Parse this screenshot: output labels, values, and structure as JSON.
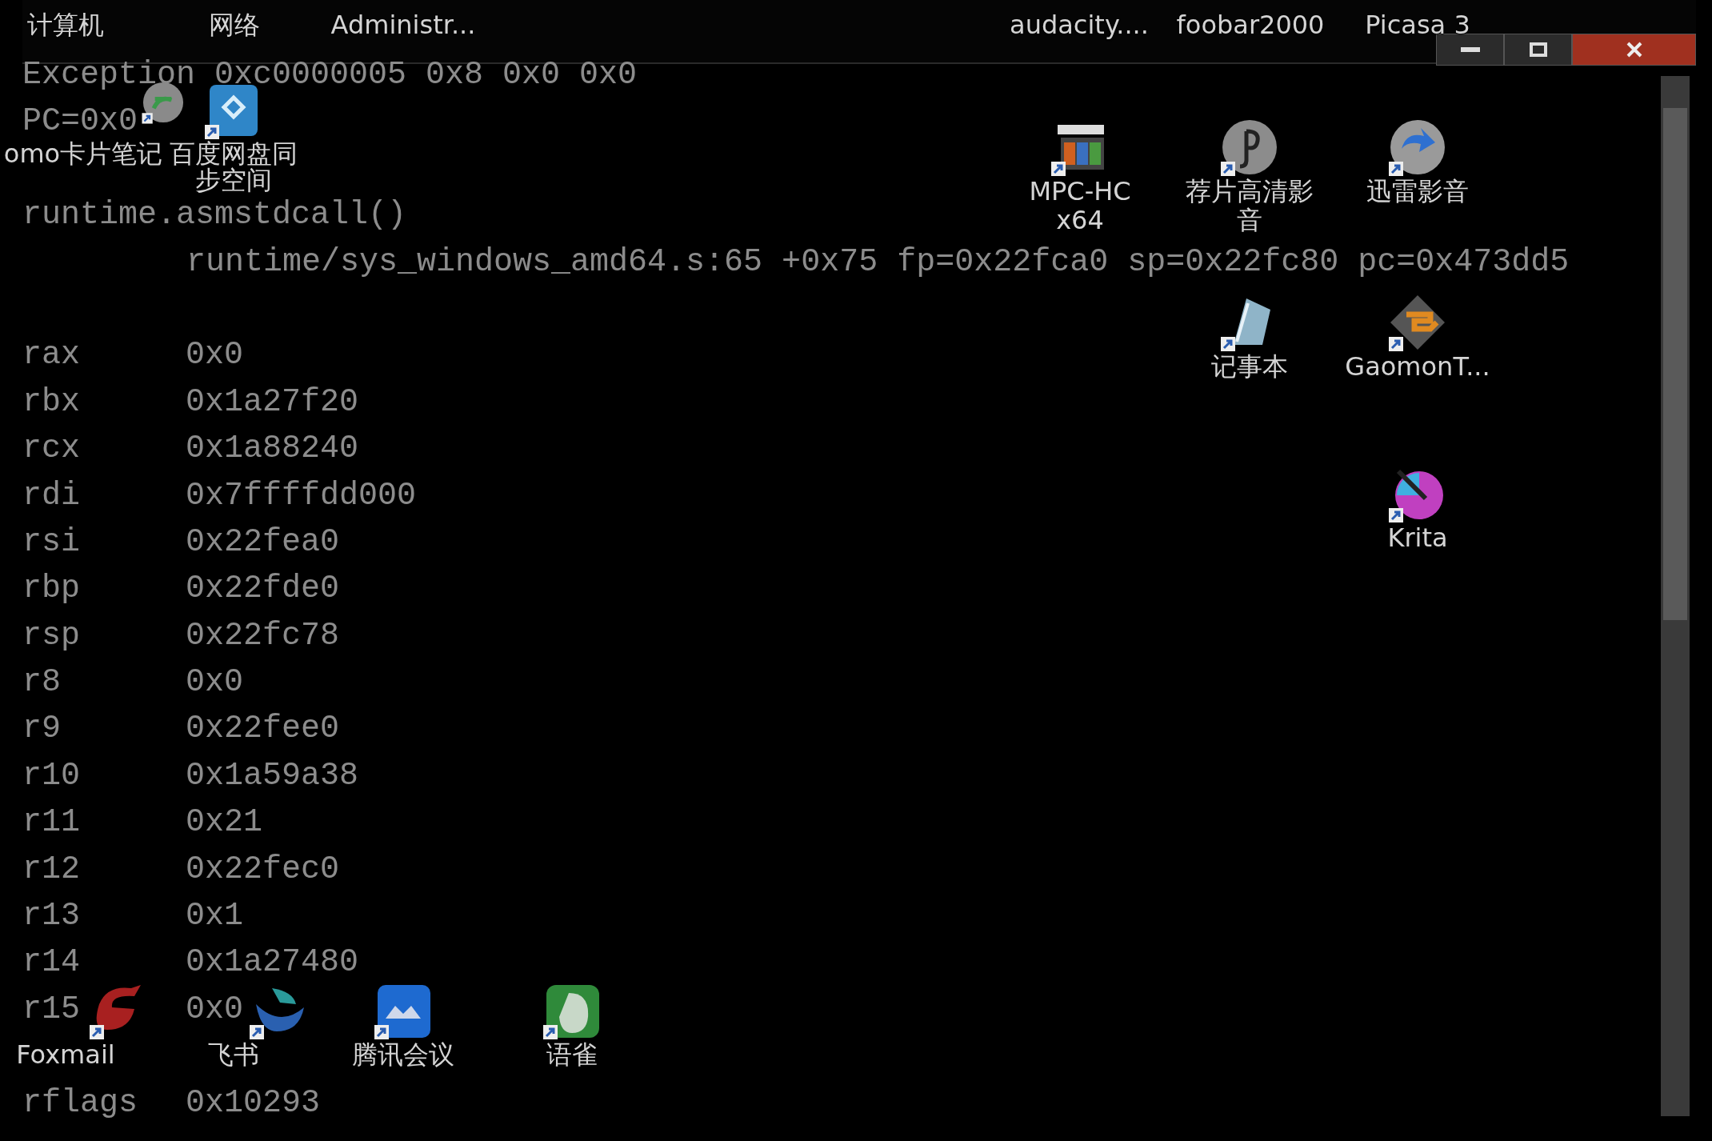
{
  "console": {
    "lines": [
      {
        "kind": "text",
        "text": "Exception 0xc0000005 0x8 0x0 0x0"
      },
      {
        "kind": "text",
        "text": "PC=0x0"
      },
      {
        "kind": "blank"
      },
      {
        "kind": "text",
        "text": "runtime.asmstdcall()"
      },
      {
        "kind": "indented",
        "text": "runtime/sys_windows_amd64.s:65 +0x75 fp=0x22fca0 sp=0x22fc80 pc=0x473dd5"
      },
      {
        "kind": "blank"
      },
      {
        "kind": "register",
        "name": "rax",
        "value": "0x0"
      },
      {
        "kind": "register",
        "name": "rbx",
        "value": "0x1a27f20"
      },
      {
        "kind": "register",
        "name": "rcx",
        "value": "0x1a88240"
      },
      {
        "kind": "register",
        "name": "rdi",
        "value": "0x7ffffdd000"
      },
      {
        "kind": "register",
        "name": "rsi",
        "value": "0x22fea0"
      },
      {
        "kind": "register",
        "name": "rbp",
        "value": "0x22fde0"
      },
      {
        "kind": "register",
        "name": "rsp",
        "value": "0x22fc78"
      },
      {
        "kind": "register",
        "name": "r8",
        "value": "0x0"
      },
      {
        "kind": "register",
        "name": "r9",
        "value": "0x22fee0"
      },
      {
        "kind": "register",
        "name": "r10",
        "value": "0x1a59a38"
      },
      {
        "kind": "register",
        "name": "r11",
        "value": "0x21"
      },
      {
        "kind": "register",
        "name": "r12",
        "value": "0x22fec0"
      },
      {
        "kind": "register",
        "name": "r13",
        "value": "0x1"
      },
      {
        "kind": "register",
        "name": "r14",
        "value": "0x1a27480"
      },
      {
        "kind": "register",
        "name": "r15",
        "value": "0x0"
      },
      {
        "kind": "blank"
      },
      {
        "kind": "register",
        "name": "rflags",
        "value": "0x10293"
      }
    ]
  },
  "desktop_icons": [
    {
      "label": "计算机",
      "kind": "cut"
    },
    {
      "label": "网络",
      "kind": "cut"
    },
    {
      "label": "Administr...",
      "kind": "cut"
    },
    {
      "label": "audacity....",
      "kind": "cut"
    },
    {
      "label": "foobar2000",
      "kind": "cut"
    },
    {
      "label": "Picasa 3",
      "kind": "cut"
    },
    {
      "label": "omo卡片笔记",
      "kind": "shown"
    },
    {
      "label": "百度网盘同步空间",
      "kind": "shown"
    },
    {
      "label": "MPC-HC x64",
      "kind": "shown"
    },
    {
      "label": "荐片高清影音",
      "kind": "shown"
    },
    {
      "label": "迅雷影音",
      "kind": "shown"
    },
    {
      "label": "记事本",
      "kind": "shown"
    },
    {
      "label": "GaomonT...",
      "kind": "shown"
    },
    {
      "label": "Krita",
      "kind": "shown"
    },
    {
      "label": "Foxmail",
      "kind": "shown"
    },
    {
      "label": "飞书",
      "kind": "shown"
    },
    {
      "label": "腾讯会议",
      "kind": "shown"
    },
    {
      "label": "语雀",
      "kind": "shown"
    }
  ]
}
